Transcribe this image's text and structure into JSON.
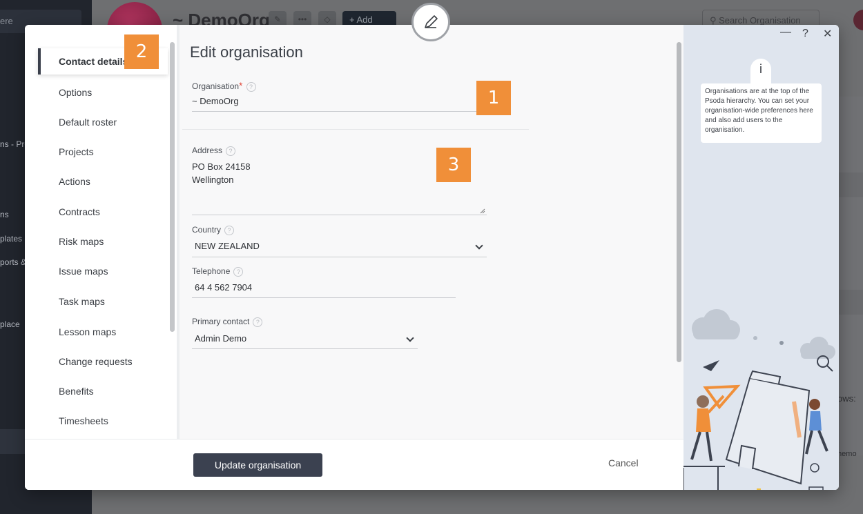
{
  "background": {
    "search_placeholder": "ere",
    "sidebar_items": [
      "ns - Pro",
      "ns",
      "plates",
      "ports &",
      "place"
    ],
    "org_title": "~ DemoOrg",
    "add_label": "Add",
    "org_search_placeholder": "Search Organisation",
    "rows_label": "ows:",
    "memo_label": "memo"
  },
  "modal": {
    "title": "Edit organisation",
    "nav": [
      {
        "label": "Contact details"
      },
      {
        "label": "Options"
      },
      {
        "label": "Default roster"
      },
      {
        "label": "Projects"
      },
      {
        "label": "Actions"
      },
      {
        "label": "Contracts"
      },
      {
        "label": "Risk maps"
      },
      {
        "label": "Issue maps"
      },
      {
        "label": "Task maps"
      },
      {
        "label": "Lesson maps"
      },
      {
        "label": "Change requests"
      },
      {
        "label": "Benefits"
      },
      {
        "label": "Timesheets"
      }
    ],
    "fields": {
      "organisation": {
        "label": "Organisation",
        "required_mark": "*",
        "value": "~ DemoOrg"
      },
      "address": {
        "label": "Address",
        "line1": "PO Box 24158",
        "line2": "Wellington"
      },
      "country": {
        "label": "Country",
        "value": "NEW ZEALAND"
      },
      "telephone": {
        "label": "Telephone",
        "value": "64 4 562 7904"
      },
      "primary_contact": {
        "label": "Primary contact",
        "value": "Admin Demo"
      }
    },
    "help_glyph": "?",
    "buttons": {
      "update": "Update organisation",
      "cancel": "Cancel"
    },
    "info": {
      "badge": "i",
      "text": "Organisations are at the top of the Psoda hierarchy. You can set your organisation-wide preferences here and also add users to the organisation.",
      "minimize": "—",
      "help": "?",
      "close": "✕"
    }
  },
  "callouts": [
    "1",
    "2",
    "3"
  ],
  "colors": {
    "accent_orange": "#f08f39",
    "button_dark": "#3b4150",
    "required_red": "#e0473a",
    "info_panel": "#dfe5ee"
  }
}
